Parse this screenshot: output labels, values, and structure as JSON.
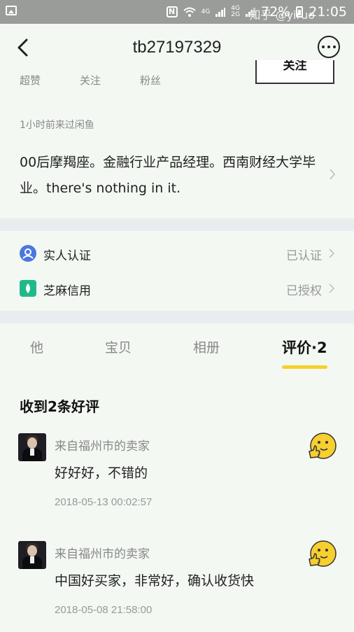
{
  "statusbar": {
    "net_1": "4G",
    "net_2": "4G",
    "net_3": "2G",
    "battery_text": "72%",
    "time": "21:05",
    "watermark": "知乎 @yiruo"
  },
  "navbar": {
    "title": "tb27197329"
  },
  "profile": {
    "stats": [
      "超赞",
      "关注",
      "粉丝"
    ],
    "follow_label": "关注",
    "last_visit": "1小时前来过闲鱼",
    "bio": "00后摩羯座。金融行业产品经理。西南财经大学毕业。there's nothing in it."
  },
  "verification": [
    {
      "label": "实人认证",
      "status": "已认证",
      "color": "#4a78e0"
    },
    {
      "label": "芝麻信用",
      "status": "已授权",
      "color": "#22b98a"
    }
  ],
  "tabs": [
    "他",
    "宝贝",
    "相册",
    "评价·2"
  ],
  "active_tab_color": "#f5d22b",
  "reviews_section": {
    "title": "收到2条好评",
    "items": [
      {
        "from": "来自福州市的卖家",
        "text": "好好好，不错的",
        "date": "2018-05-13 00:02:57"
      },
      {
        "from": "来自福州市的卖家",
        "text": "中国好买家，非常好，确认收货快",
        "date": "2018-05-08 21:58:00"
      }
    ]
  }
}
